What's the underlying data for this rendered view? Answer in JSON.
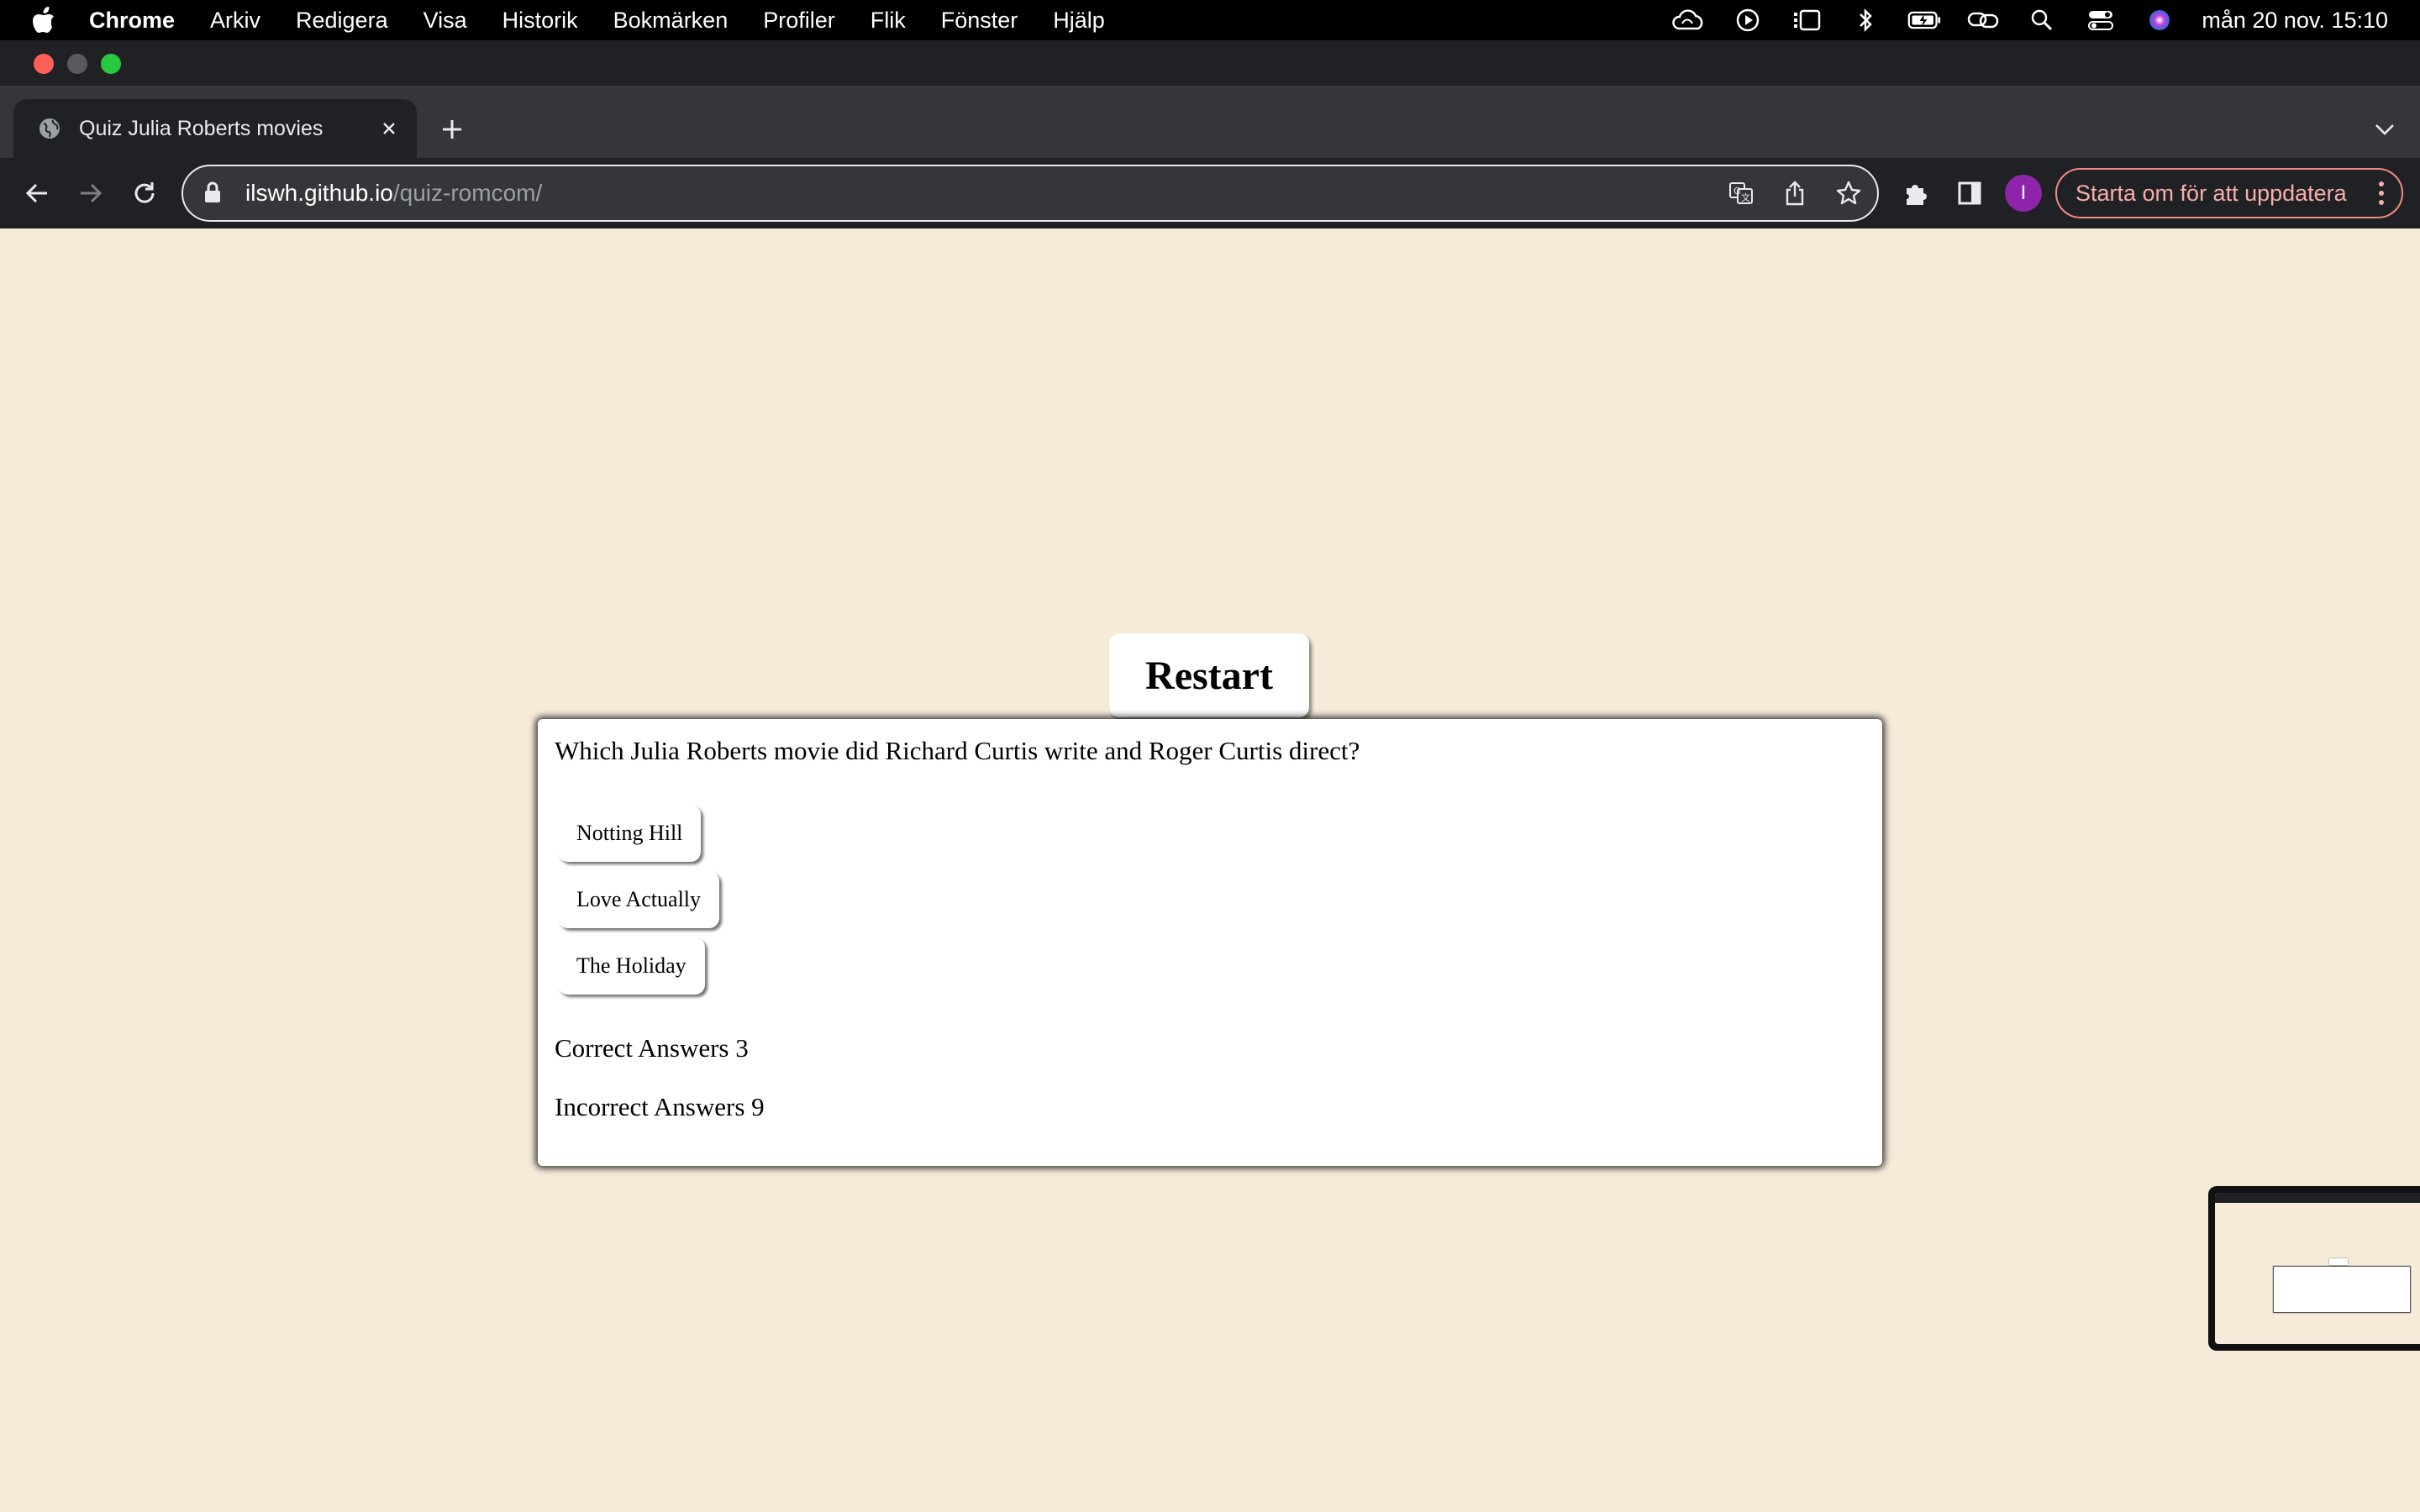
{
  "menubar": {
    "app": "Chrome",
    "items": [
      "Arkiv",
      "Redigera",
      "Visa",
      "Historik",
      "Bokmärken",
      "Profiler",
      "Flik",
      "Fönster",
      "Hjälp"
    ],
    "clock": "mån 20 nov. 15:10",
    "status_icons": [
      "creative-cloud-icon",
      "play-icon",
      "stage-manager-icon",
      "bluetooth-icon",
      "battery-icon",
      "link-icon",
      "spotlight-search-icon",
      "control-center-icon",
      "siri-icon"
    ]
  },
  "browser": {
    "tab_title": "Quiz Julia Roberts movies",
    "url_host": "ilswh.github.io",
    "url_path": "/quiz-romcom/",
    "avatar_initial": "I",
    "update_label": "Starta om för att uppdatera",
    "accent_update": "#f28b82",
    "avatar_color": "#8e24aa"
  },
  "page": {
    "background": "#f6ead9",
    "restart_label": "Restart",
    "question": "Which Julia Roberts movie did Richard Curtis write and Roger Curtis direct?",
    "answers": [
      "Notting Hill",
      "Love Actually",
      "The Holiday"
    ],
    "correct_label": "Correct Answers 3",
    "incorrect_label": "Incorrect Answers 9"
  }
}
